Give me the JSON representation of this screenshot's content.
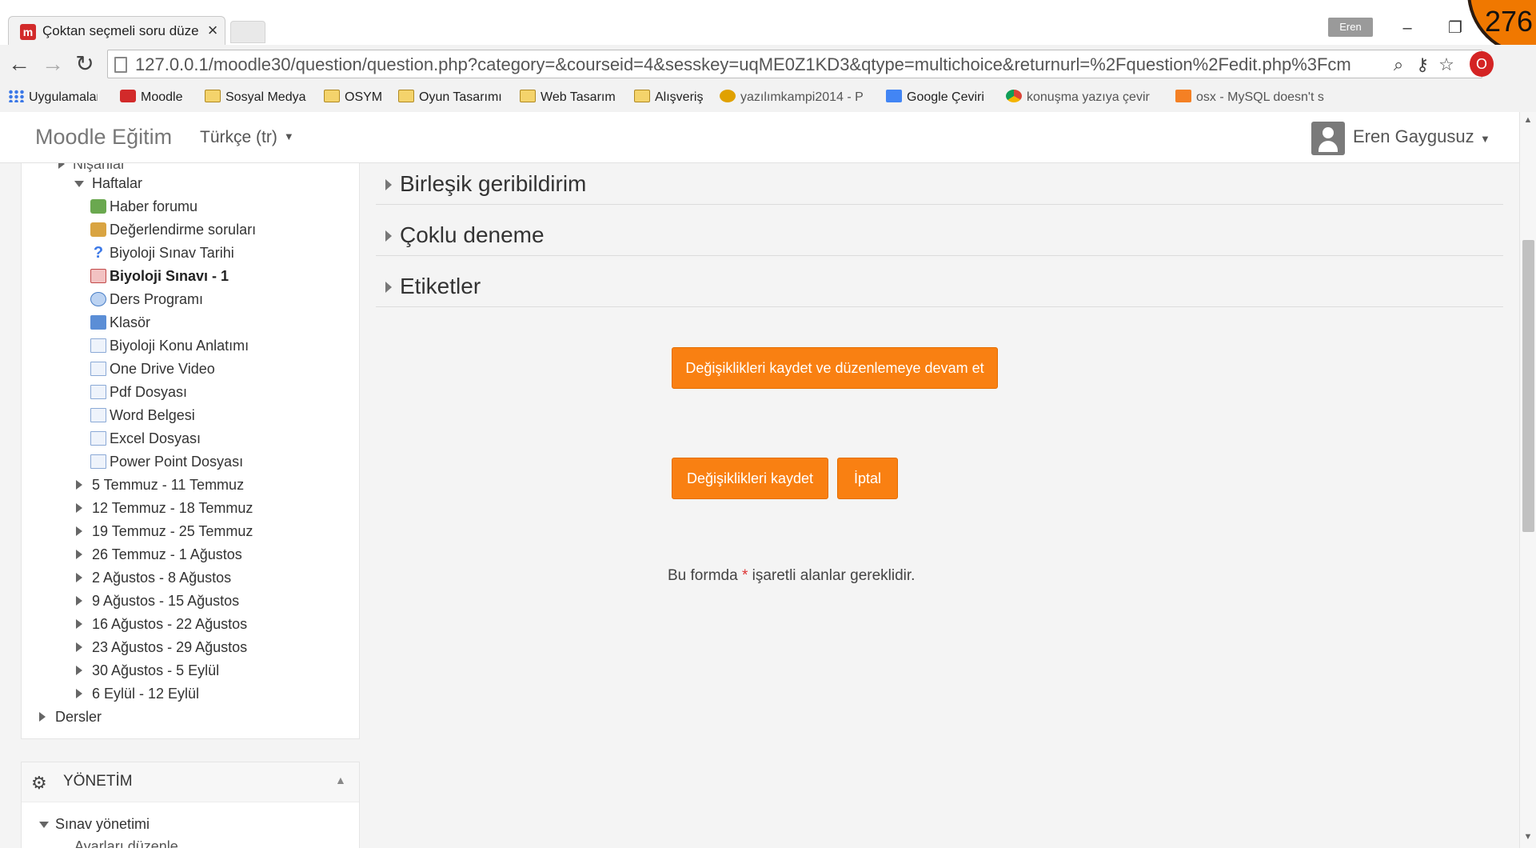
{
  "browser": {
    "tab_title": "Çoktan seçmeli soru düze",
    "tab_close": "×",
    "profile_name": "Eren",
    "window_minimize": "–",
    "window_restore": "❐",
    "overlay_counter": "276",
    "back": "←",
    "forward": "→",
    "reload": "↻",
    "url": "127.0.0.1/moodle30/question/question.php?category=&courseid=4&sesskey=uqME0Z1KD3&qtype=multichoice&returnurl=%2Fquestion%2Fedit.php%3Fcm",
    "icons": {
      "zoom": "search-icon",
      "key": "key-icon",
      "star": "star-icon",
      "extension": "opera-icon"
    },
    "bookmarks": [
      {
        "label": "Uygulamalar",
        "icon": "apps-grid-icon"
      },
      {
        "label": "Moodle",
        "icon": "moodle-icon"
      },
      {
        "label": "Sosyal Medya",
        "icon": "folder-icon"
      },
      {
        "label": "OSYM",
        "icon": "folder-icon"
      },
      {
        "label": "Oyun Tasarımı",
        "icon": "folder-icon"
      },
      {
        "label": "Web Tasarım",
        "icon": "folder-icon"
      },
      {
        "label": "Alışveriş",
        "icon": "folder-icon"
      },
      {
        "label": "yazılımkampi2014 - P",
        "icon": "cat-icon"
      },
      {
        "label": "Google Çeviri",
        "icon": "google-translate-icon"
      },
      {
        "label": "konuşma yazıya çevir",
        "icon": "chrome-icon"
      },
      {
        "label": "osx - MySQL doesn't s",
        "icon": "stackoverflow-icon"
      }
    ]
  },
  "moodle": {
    "site_name": "Moodle Eğitim",
    "language": "Türkçe (tr)",
    "user_name": "Eren Gaygusuz",
    "nav": {
      "partial_item": "Nişanlar",
      "weeks_label": "Haftalar",
      "activities": [
        {
          "label": "Haber forumu",
          "icon": "forum-icon"
        },
        {
          "label": "Değerlendirme soruları",
          "icon": "quiz-icon"
        },
        {
          "label": "Biyoloji Sınav Tarihi",
          "icon": "question-icon"
        },
        {
          "label": "Biyoloji Sınavı - 1",
          "icon": "checkmark-quiz-icon"
        },
        {
          "label": "Ders Programı",
          "icon": "url-icon"
        },
        {
          "label": "Klasör",
          "icon": "folder-icon"
        },
        {
          "label": "Biyoloji Konu Anlatımı",
          "icon": "file-icon"
        },
        {
          "label": "One Drive Video",
          "icon": "file-icon"
        },
        {
          "label": "Pdf Dosyası",
          "icon": "file-icon"
        },
        {
          "label": "Word Belgesi",
          "icon": "file-icon"
        },
        {
          "label": "Excel Dosyası",
          "icon": "file-icon"
        },
        {
          "label": "Power Point Dosyası",
          "icon": "file-icon"
        }
      ],
      "weeks": [
        "5 Temmuz - 11 Temmuz",
        "12 Temmuz - 18 Temmuz",
        "19 Temmuz - 25 Temmuz",
        "26 Temmuz - 1 Ağustos",
        "2 Ağustos - 8 Ağustos",
        "9 Ağustos - 15 Ağustos",
        "16 Ağustos - 22 Ağustos",
        "23 Ağustos - 29 Ağustos",
        "30 Ağustos - 5 Eylül",
        "6 Eylül - 12 Eylül"
      ],
      "courses_label": "Dersler"
    },
    "admin": {
      "title": "YÖNETİM",
      "quiz_admin": "Sınav yönetimi",
      "partial_item": "Ayarları düzenle"
    },
    "sections": [
      "Birleşik geribildirim",
      "Çoklu deneme",
      "Etiketler"
    ],
    "buttons": {
      "save_continue": "Değişiklikleri kaydet ve düzenlemeye devam et",
      "save": "Değişiklikleri kaydet",
      "cancel": "İptal"
    },
    "required_note": {
      "before": "Bu formda",
      "star": "*",
      "after": "işaretli alanlar gereklidir."
    }
  },
  "colors": {
    "accent_orange": "#f98012",
    "link_blue": "#3b78e7",
    "required_red": "#d33333"
  }
}
